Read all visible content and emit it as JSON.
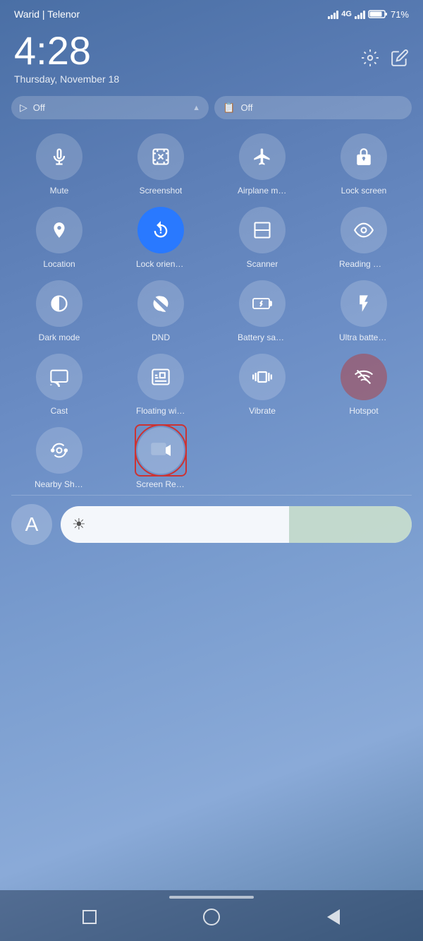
{
  "status": {
    "carrier": "Warid | Telenor",
    "battery": "71%",
    "network": "4G"
  },
  "clock": {
    "time": "4:28",
    "date": "Thursday, November 18"
  },
  "quick_pills": [
    {
      "icon": "▷",
      "label": "Off"
    },
    {
      "icon": "📋",
      "label": "Off"
    }
  ],
  "grid": [
    {
      "icon": "🔔",
      "label": "Mute",
      "active": false
    },
    {
      "icon": "✂",
      "label": "Screenshot",
      "active": false
    },
    {
      "icon": "✈",
      "label": "Airplane mode",
      "active": false
    },
    {
      "icon": "🔒",
      "label": "Lock screen",
      "active": false
    },
    {
      "icon": "◂",
      "label": "Location",
      "active": false
    },
    {
      "icon": "🔄",
      "label": "Lock orientati",
      "active": true
    },
    {
      "icon": "⬜",
      "label": "Scanner",
      "active": false
    },
    {
      "icon": "👁",
      "label": "Reading mode",
      "active": false
    },
    {
      "icon": "◑",
      "label": "Dark mode",
      "active": false
    },
    {
      "icon": "🌙",
      "label": "DND",
      "active": false
    },
    {
      "icon": "🔋",
      "label": "Battery saver",
      "active": false
    },
    {
      "icon": "⚡",
      "label": "Ultra battery s",
      "active": false
    },
    {
      "icon": "🖥",
      "label": "Cast",
      "active": false
    },
    {
      "icon": "⊞",
      "label": "Floating windo",
      "active": false
    },
    {
      "icon": "📳",
      "label": "Vibrate",
      "active": false
    },
    {
      "icon": "📶",
      "label": "Hotspot",
      "active": false,
      "special": "hotspot"
    },
    {
      "icon": "∞",
      "label": "Nearby Share",
      "active": false
    },
    {
      "icon": "🎥",
      "label": "Screen Recor",
      "active": false,
      "special": "screen-record"
    }
  ],
  "bottom": {
    "avatar_label": "A",
    "brightness_icon": "☀"
  },
  "nav": {
    "square": "",
    "circle": "",
    "back": ""
  }
}
